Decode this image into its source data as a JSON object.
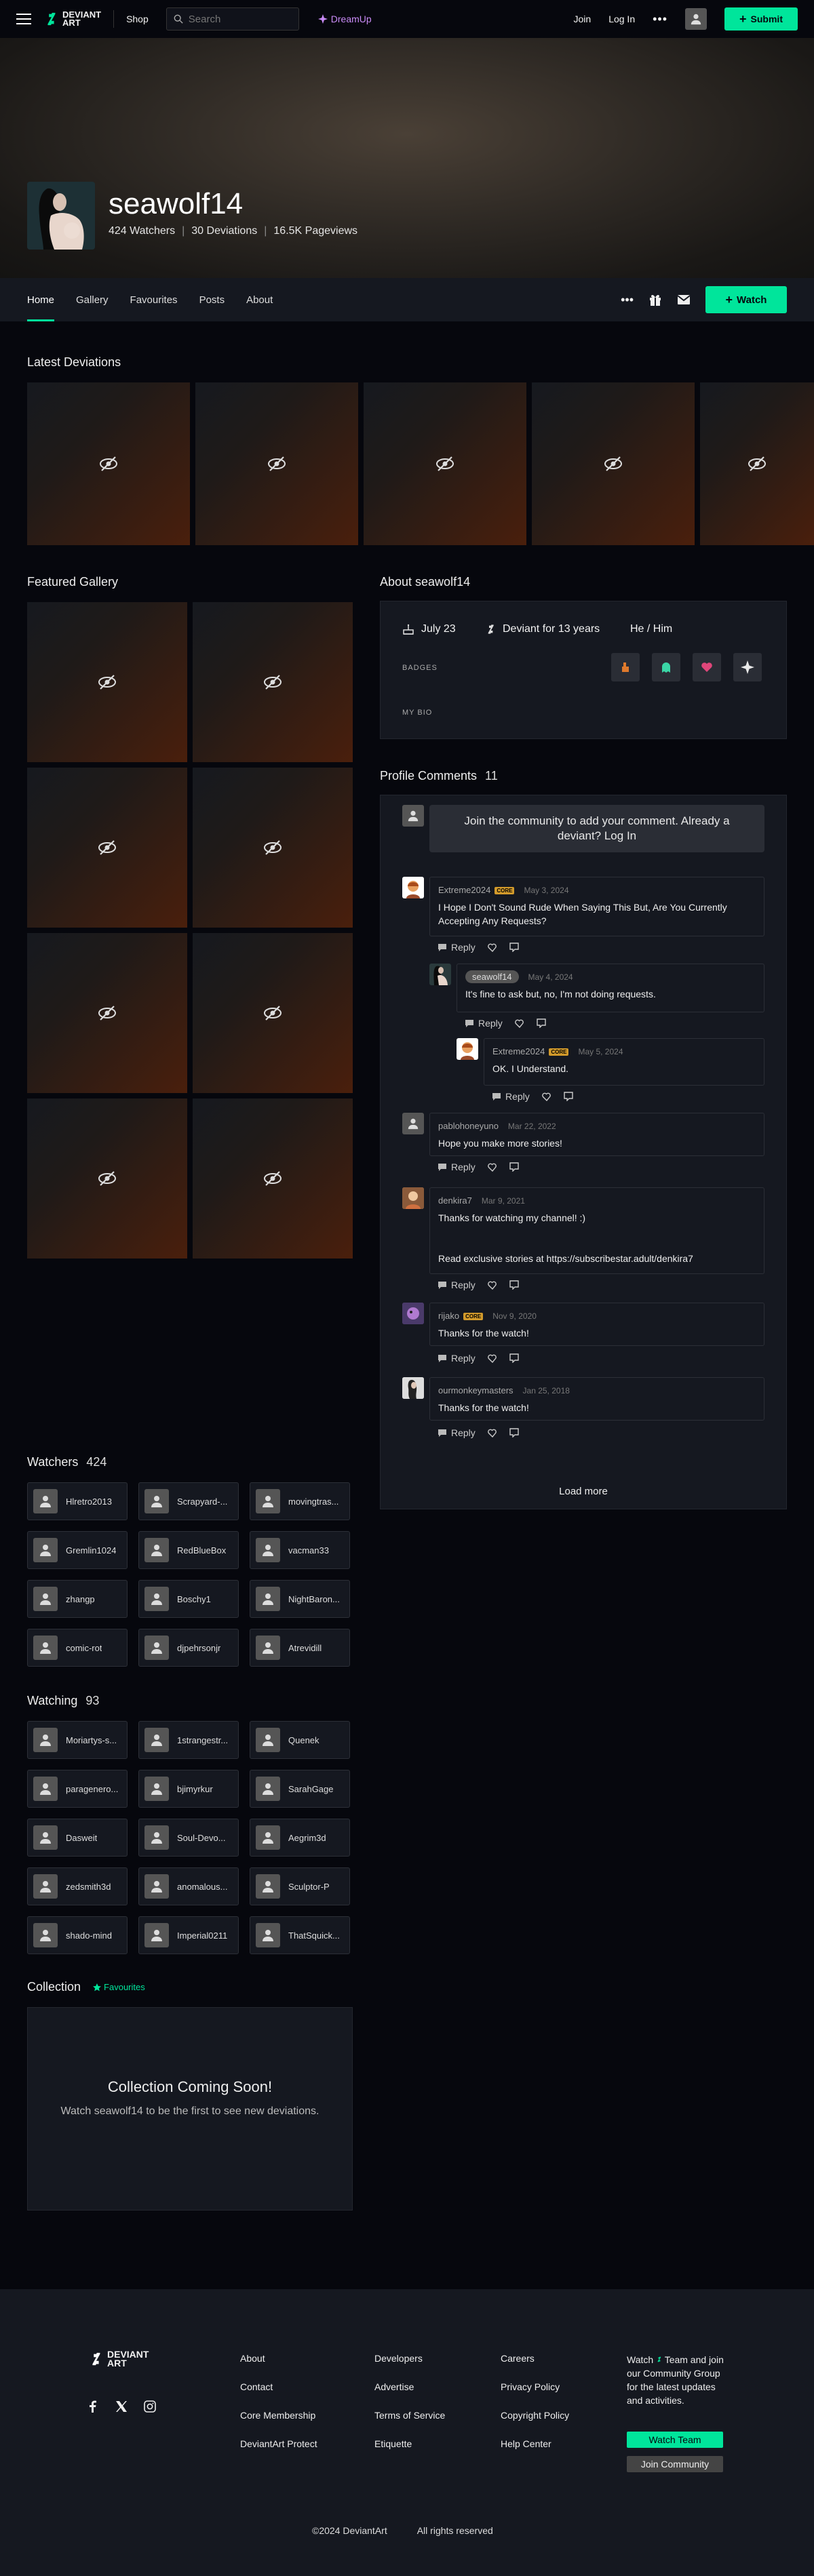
{
  "header": {
    "logo_text_1": "DEVIANT",
    "logo_text_2": "ART",
    "shop": "Shop",
    "search_placeholder": "Search",
    "dreamup": "DreamUp",
    "join": "Join",
    "login": "Log In",
    "submit": "Submit"
  },
  "profile": {
    "username": "seawolf14",
    "watchers": "424 Watchers",
    "deviations": "30 Deviations",
    "pageviews": "16.5K Pageviews"
  },
  "tabs": [
    "Home",
    "Gallery",
    "Favourites",
    "Posts",
    "About"
  ],
  "watch_label": "Watch",
  "latest": {
    "title": "Latest Deviations"
  },
  "featured": {
    "title": "Featured Gallery"
  },
  "about": {
    "title": "About seawolf14",
    "birthday": "July 23",
    "deviant_for": "Deviant for 13 years",
    "pronouns": "He / Him",
    "badges_label": "BADGES",
    "bio_label": "MY BIO"
  },
  "comments": {
    "title": "Profile Comments",
    "count": "11",
    "join_prompt": "Join the community to add your comment. Already a deviant? Log In",
    "reply": "Reply",
    "core": "CORE",
    "load_more": "Load more",
    "items": [
      {
        "name": "Extreme2024",
        "date": "May 3, 2024",
        "text": "I Hope I Don't Sound Rude When Saying This But, Are You Currently Accepting Any Requests?"
      },
      {
        "name": "seawolf14",
        "date": "May 4, 2024",
        "text": "It's fine to ask but, no, I'm not doing requests."
      },
      {
        "name": "Extreme2024",
        "date": "May 5, 2024",
        "text": "OK. I Understand."
      },
      {
        "name": "pablohoneyuno",
        "date": "Mar 22, 2022",
        "text": "Hope you make more stories!"
      },
      {
        "name": "denkira7",
        "date": "Mar 9, 2021",
        "text": "Thanks for watching my channel! :)",
        "text2": "Read exclusive stories at https://subscribestar.adult/denkira7"
      },
      {
        "name": "rijako",
        "date": "Nov 9, 2020",
        "text": "Thanks for the watch!"
      },
      {
        "name": "ourmonkeymasters",
        "date": "Jan 25, 2018",
        "text": "Thanks for the watch!"
      }
    ]
  },
  "watchers": {
    "title": "Watchers",
    "count": "424",
    "items": [
      "Hlretro2013",
      "Scrapyard-...",
      "movingtras...",
      "Gremlin1024",
      "RedBlueBox",
      "vacman33",
      "zhangp",
      "Boschy1",
      "NightBaron...",
      "comic-rot",
      "djpehrsonjr",
      "Atrevidill"
    ]
  },
  "watching": {
    "title": "Watching",
    "count": "93",
    "items": [
      "Moriartys-s...",
      "1strangestr...",
      "Quenek",
      "paragenero...",
      "bjimyrkur",
      "SarahGage",
      "Dasweit",
      "Soul-Devo...",
      "Aegrim3d",
      "zedsmith3d",
      "anomalous...",
      "Sculptor-P",
      "shado-mind",
      "Imperial0211",
      "ThatSquick..."
    ]
  },
  "collection": {
    "title": "Collection",
    "favourites": "Favourites",
    "coming_title": "Collection Coming Soon!",
    "coming_sub": "Watch seawolf14 to be the first to see new deviations."
  },
  "footer": {
    "col1": [
      "About",
      "Contact",
      "Core Membership",
      "DeviantArt Protect"
    ],
    "col2": [
      "Developers",
      "Advertise",
      "Terms of Service",
      "Etiquette"
    ],
    "col3": [
      "Careers",
      "Privacy Policy",
      "Copyright Policy",
      "Help Center"
    ],
    "team_pre": "Watch",
    "team_rest": "Team and join our Community Group for the latest updates and activities.",
    "watch_team": "Watch Team",
    "join_community": "Join Community",
    "copyright": "©2024 DeviantArt",
    "rights": "All rights reserved"
  },
  "colors": {
    "accent": "#00e59b",
    "dreamup": "#c98bf7",
    "core_badge": "#d29a2b"
  }
}
